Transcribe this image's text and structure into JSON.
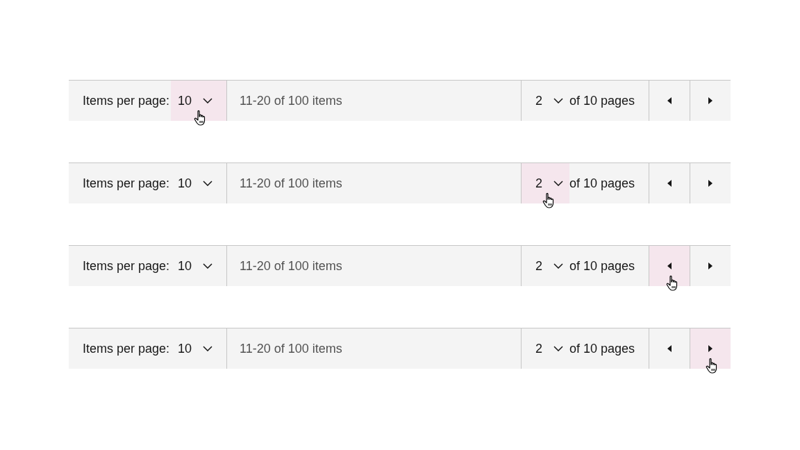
{
  "paginations": [
    {
      "items_per_page_label": "Items per page:",
      "page_size": {
        "value": "10",
        "hovered": true
      },
      "range": "11-20 of 100 items",
      "page": {
        "value": "2",
        "hovered": false
      },
      "page_total": "of 10 pages",
      "prev_button": {
        "hovered": false
      },
      "next_button": {
        "hovered": false
      }
    },
    {
      "items_per_page_label": "Items per page:",
      "page_size": {
        "value": "10",
        "hovered": false
      },
      "range": "11-20 of 100 items",
      "page": {
        "value": "2",
        "hovered": true
      },
      "page_total": "of 10 pages",
      "prev_button": {
        "hovered": false
      },
      "next_button": {
        "hovered": false
      }
    },
    {
      "items_per_page_label": "Items per page:",
      "page_size": {
        "value": "10",
        "hovered": false
      },
      "range": "11-20 of 100 items",
      "page": {
        "value": "2",
        "hovered": false
      },
      "page_total": "of 10 pages",
      "prev_button": {
        "hovered": true
      },
      "next_button": {
        "hovered": false
      }
    },
    {
      "items_per_page_label": "Items per page:",
      "page_size": {
        "value": "10",
        "hovered": false
      },
      "range": "11-20 of 100 items",
      "page": {
        "value": "2",
        "hovered": false
      },
      "page_total": "of 10 pages",
      "prev_button": {
        "hovered": false
      },
      "next_button": {
        "hovered": true
      }
    }
  ]
}
